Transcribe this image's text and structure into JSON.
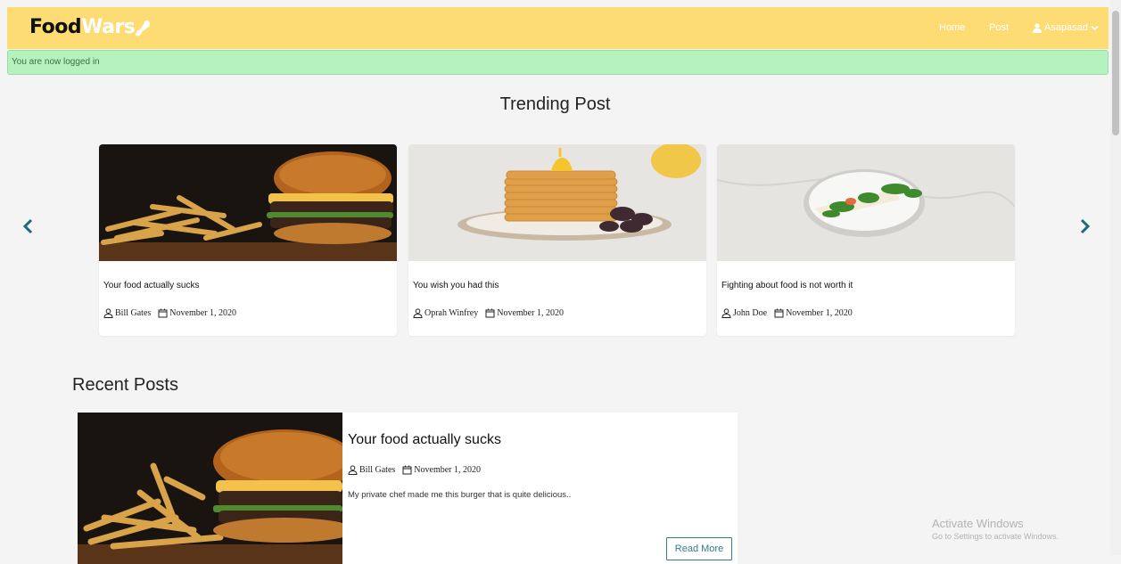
{
  "brand": {
    "part1": "Food",
    "part2": "Wars"
  },
  "nav": {
    "home": "Home",
    "post": "Post",
    "user": "Asapasad"
  },
  "alert": {
    "text": "You are now logged in"
  },
  "trending": {
    "title": "Trending Post",
    "cards": [
      {
        "title": "Your food actually sucks",
        "author": "Bill Gates",
        "date": "November 1, 2020"
      },
      {
        "title": "You wish you had this",
        "author": "Oprah Winfrey",
        "date": "November 1, 2020"
      },
      {
        "title": "Fighting about food is not worth it",
        "author": "John Doe",
        "date": "November 1, 2020"
      }
    ]
  },
  "recent": {
    "title": "Recent Posts",
    "posts": [
      {
        "title": "Your food actually sucks",
        "author": "Bill Gates",
        "date": "November 1, 2020",
        "excerpt": "My private chef made me this burger that is quite delicious..",
        "button": "Read More"
      }
    ]
  },
  "watermark": {
    "line1": "Activate Windows",
    "line2": "Go to Settings to activate Windows."
  },
  "icons": {
    "arrows": [
      "chevron-left-icon",
      "chevron-right-icon"
    ],
    "meta": [
      "user-icon",
      "calendar-icon"
    ]
  },
  "colors": {
    "navbar": "#fddc73",
    "alert": "#b6f2bf",
    "accent": "#1d6b78"
  }
}
